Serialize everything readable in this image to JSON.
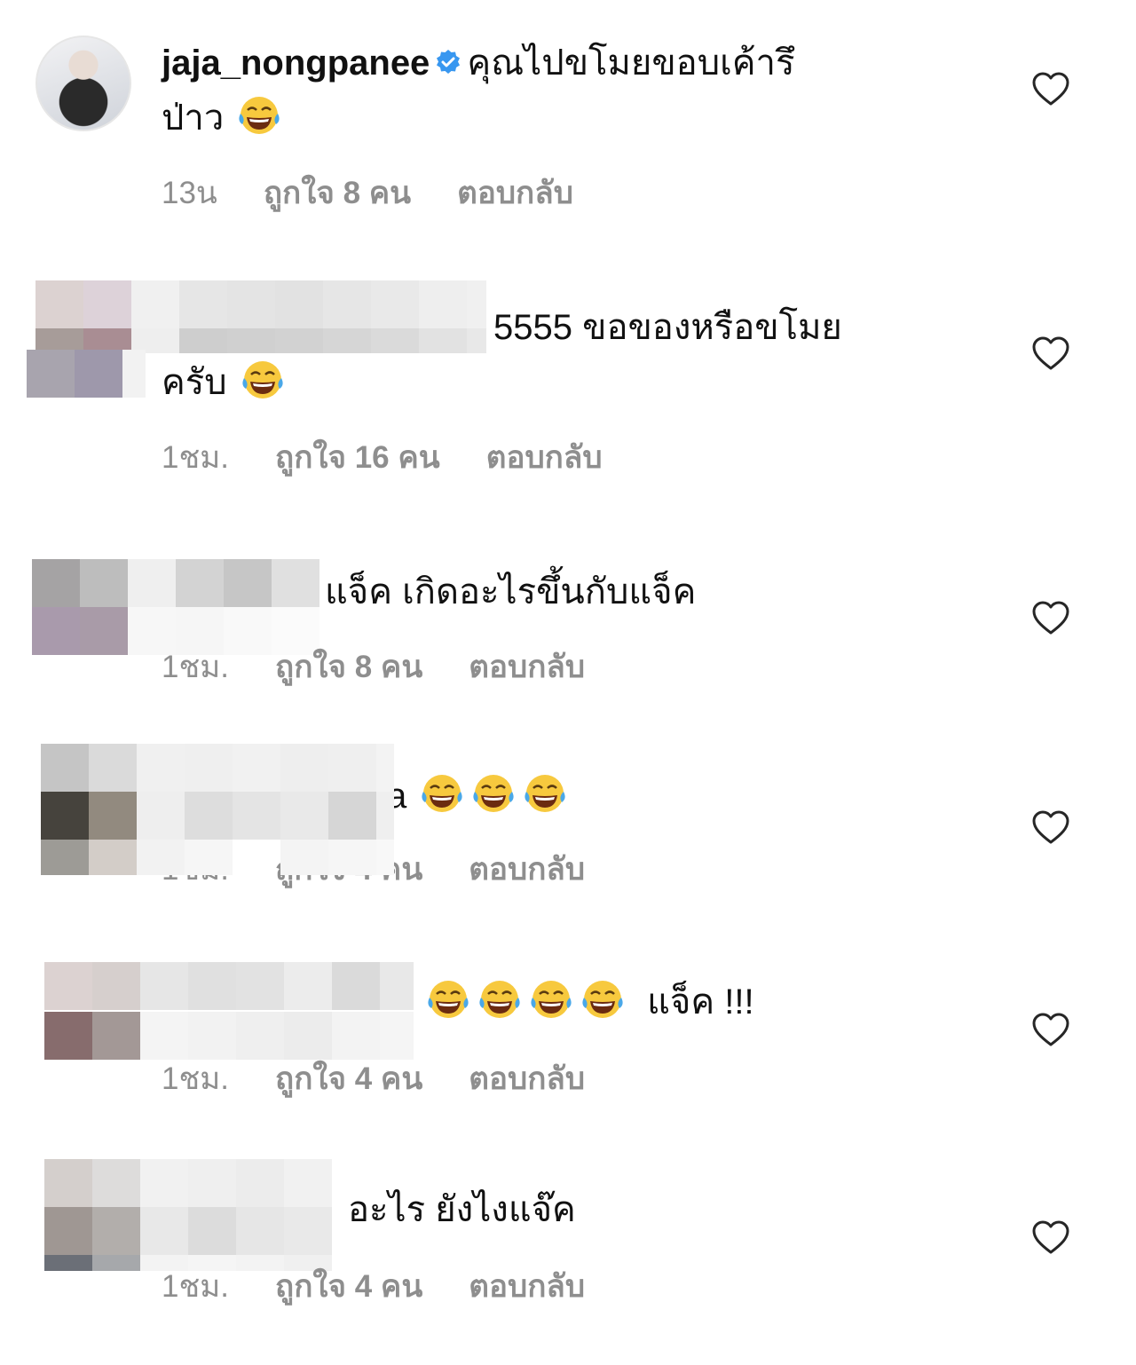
{
  "comments": [
    {
      "username": "jaja_nongpanee",
      "verified": true,
      "text_line1": "คุณไปขโมยขอบเค้ารึ",
      "text_line2": "ป่าว",
      "time": "13น",
      "likes": "ถูกใจ 8 คน",
      "reply": "ตอบกลับ"
    },
    {
      "text_line1": "5555 ขอของหรือขโมย",
      "text_line2": "ครับ",
      "time": "1ชม.",
      "likes": "ถูกใจ 16 คน",
      "reply": "ตอบกลับ"
    },
    {
      "text_line1": "แจ็ค  เกิดอะไรขึ้นกับแจ็ค",
      "time": "1ชม.",
      "likes": "ถูกใจ 8 คน",
      "reply": "ตอบกลับ"
    },
    {
      "text_line1": "a",
      "time": "1ชม.",
      "likes": "ถูกใจ 4 คน",
      "reply": "ตอบกลับ"
    },
    {
      "text_line1": "แจ็ค !!!",
      "time": "1ชม.",
      "likes": "ถูกใจ 4 คน",
      "reply": "ตอบกลับ"
    },
    {
      "text_line1": "อะไร ยังไงแจ๊ค",
      "time": "1ชม.",
      "likes": "ถูกใจ 4 คน",
      "reply": "ตอบกลับ"
    }
  ],
  "colors": {
    "meta_gray": "#8e8e8e",
    "verified_blue": "#3897f0",
    "heart_outline": "#262626"
  },
  "icons": {
    "verified": "verified-badge-icon",
    "emoji": "face-with-tears-of-joy-emoji",
    "heart": "heart-outline-icon"
  }
}
